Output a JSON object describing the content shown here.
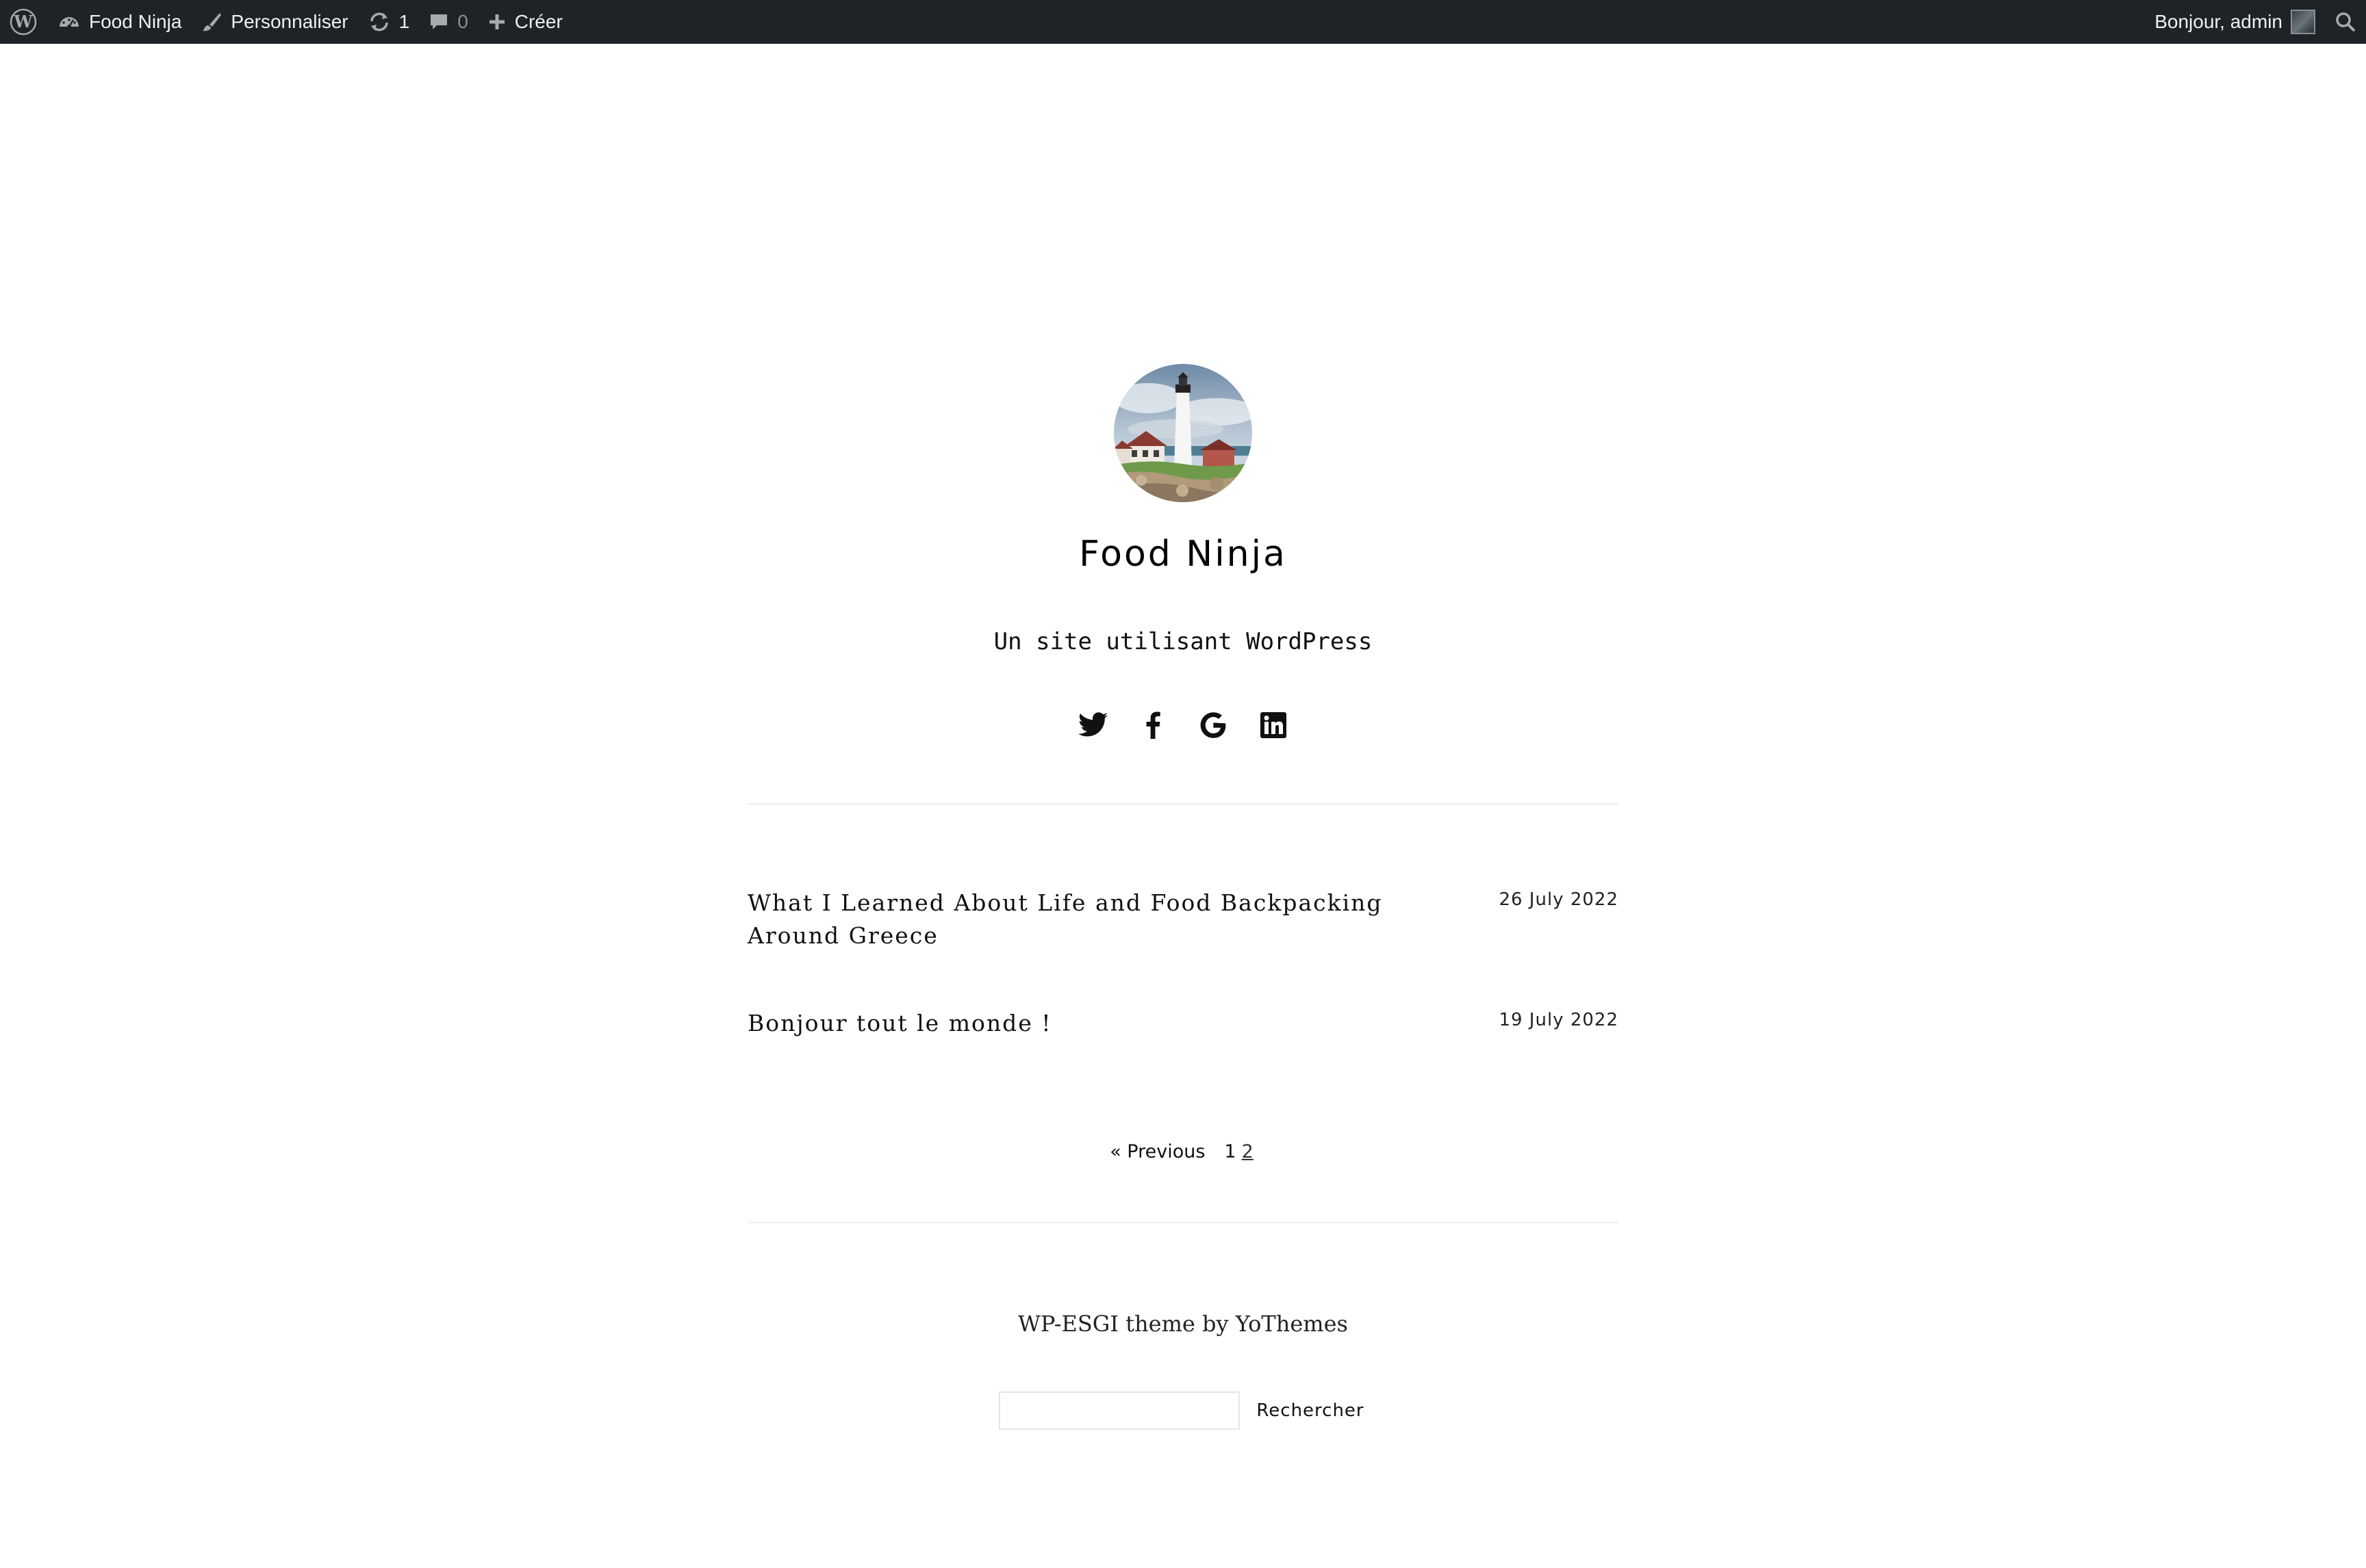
{
  "adminbar": {
    "site_name": "Food Ninja",
    "customize_label": "Personnaliser",
    "updates_count": "1",
    "comments_count": "0",
    "new_label": "Créer",
    "greeting": "Bonjour, admin"
  },
  "header": {
    "site_title": "Food Ninja",
    "tagline": "Un site utilisant WordPress",
    "social": [
      "twitter-icon",
      "facebook-icon",
      "google-icon",
      "linkedin-icon"
    ]
  },
  "posts": [
    {
      "title": "What I Learned About Life and Food Backpacking Around Greece",
      "date": "26 July 2022"
    },
    {
      "title": "Bonjour tout le monde !",
      "date": "19 July 2022"
    }
  ],
  "pagination": {
    "previous_label": "« Previous",
    "pages": [
      "1",
      "2"
    ],
    "current_page": "1"
  },
  "footer": {
    "credit": "WP-ESGI theme by YoThemes",
    "search_placeholder": "",
    "search_button": "Rechercher"
  },
  "colors": {
    "adminbar_bg": "#1d2327",
    "adminbar_text": "#f0f0f1",
    "adminbar_muted": "#8c8f94",
    "divider": "#ececec"
  }
}
